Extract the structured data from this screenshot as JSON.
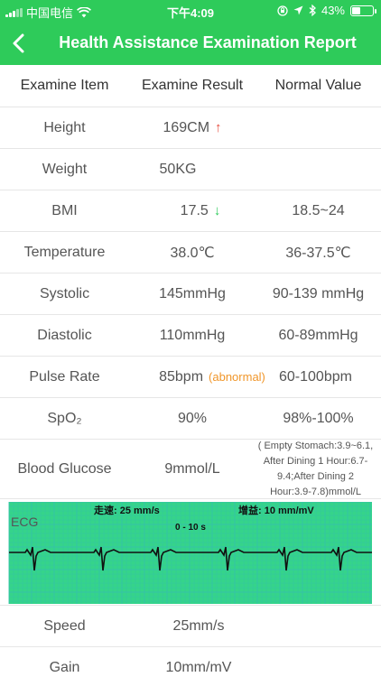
{
  "status_bar": {
    "carrier": "中国电信",
    "time": "下午4:09",
    "battery_text": "43%",
    "battery_level": 0.43
  },
  "nav": {
    "title": "Health Assistance Examination Report",
    "back_icon": "chevron-left-icon"
  },
  "table": {
    "headers": [
      "Examine Item",
      "Examine Result",
      "Normal Value"
    ],
    "rows": [
      {
        "item": "Height",
        "result": "169CM",
        "flag": "up",
        "normal": ""
      },
      {
        "item": "Weight",
        "result": "50KG",
        "flag": "",
        "normal": ""
      },
      {
        "item": "BMI",
        "result": "17.5",
        "flag": "down",
        "normal": "18.5~24"
      },
      {
        "item": "Temperature",
        "result": "38.0℃",
        "flag": "",
        "normal": "36-37.5℃"
      },
      {
        "item": "Systolic",
        "result": "145mmHg",
        "flag": "",
        "normal": "90-139 mmHg"
      },
      {
        "item": "Diastolic",
        "result": "110mmHg",
        "flag": "",
        "normal": "60-89mmHg"
      },
      {
        "item": "Pulse Rate",
        "result": "85bpm",
        "note": "(abnormal)",
        "flag": "",
        "normal": "60-100bpm"
      },
      {
        "item": "SpO₂",
        "result": "90%",
        "flag": "",
        "normal": "98%-100%"
      },
      {
        "item": "Blood Glucose",
        "result": "9mmol/L",
        "flag": "",
        "normal": "( Empty Stomach:3.9~6.1, After Dining 1 Hour:6.7-9.4;After Dining 2 Hour:3.9-7.8)mmol/L"
      }
    ]
  },
  "ecg": {
    "label": "ECG",
    "speed_label": "走速: 25 mm/s",
    "gain_label": "增益: 10 mm/mV",
    "range_label": "0 - 10 s",
    "grid_color": "#35c2a8",
    "bg_color": "#35d48a",
    "trace_color": "#111111"
  },
  "footer_rows": [
    {
      "item": "Speed",
      "result": "25mm/s"
    },
    {
      "item": "Gain",
      "result": "10mm/mV"
    }
  ],
  "colors": {
    "brand": "#2ecb5a",
    "up": "#e64b3c",
    "down": "#2ecb5a",
    "abnormal": "#f0962a"
  }
}
